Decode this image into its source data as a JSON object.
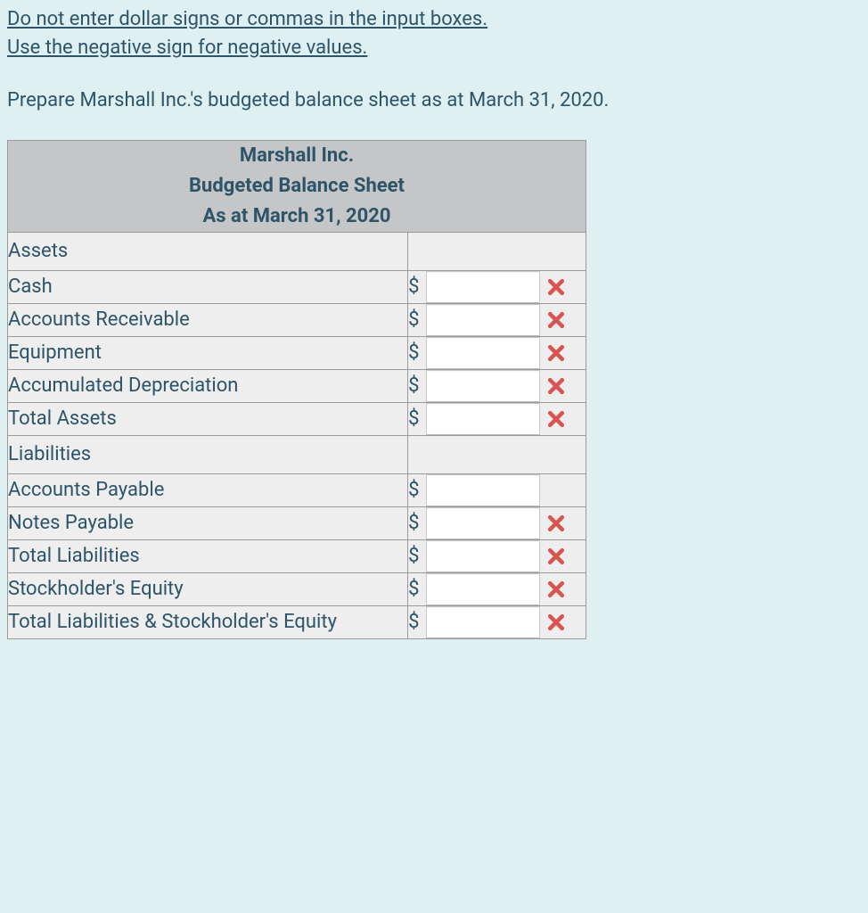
{
  "instructions": {
    "line1": "Do not enter dollar signs or commas in the input boxes.",
    "line2": "Use the negative sign for negative values."
  },
  "prompt": "Prepare Marshall Inc.'s budgeted balance sheet as at March 31, 2020.",
  "header": {
    "company": "Marshall Inc.",
    "report": "Budgeted Balance Sheet",
    "asat": "As at March 31, 2020"
  },
  "currency_symbol": "$",
  "sections": {
    "assets_heading": "Assets",
    "liabilities_heading": "Liabilities"
  },
  "rows": {
    "cash": {
      "label": "Cash",
      "value": "",
      "has_x": true
    },
    "ar": {
      "label": "Accounts Receivable",
      "value": "",
      "has_x": true
    },
    "equipment": {
      "label": "Equipment",
      "value": "",
      "has_x": true
    },
    "acc_dep": {
      "label": "Accumulated Depreciation",
      "value": "",
      "has_x": true
    },
    "total_assets": {
      "label": "Total Assets",
      "value": "",
      "has_x": true
    },
    "ap": {
      "label": "Accounts Payable",
      "value": "",
      "has_x": false
    },
    "np": {
      "label": "Notes Payable",
      "value": "",
      "has_x": true
    },
    "total_liab": {
      "label": "Total Liabilities",
      "value": "",
      "has_x": true
    },
    "se": {
      "label": "Stockholder's Equity",
      "value": "",
      "has_x": true
    },
    "total_liab_se": {
      "label": "Total Liabilities & Stockholder's Equity",
      "value": "",
      "has_x": true
    }
  },
  "colors": {
    "accent_red": "#d9534f",
    "text": "#2d5468"
  }
}
